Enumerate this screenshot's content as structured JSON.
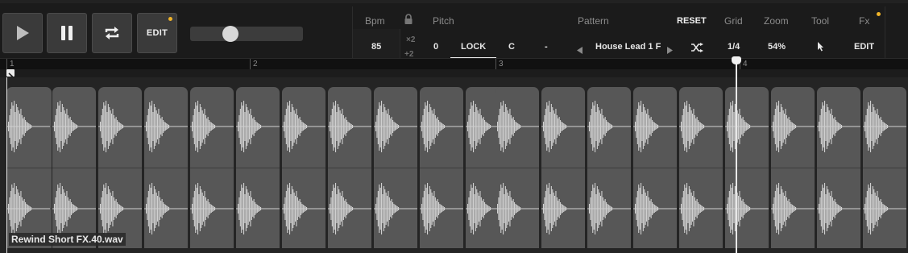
{
  "toolbar": {
    "play_label": "",
    "edit_label": "EDIT",
    "slider_value": 0.33
  },
  "params": {
    "bpm_label": "Bpm",
    "bpm_value": "85",
    "pitch_label": "Pitch",
    "mult_x2": "×2",
    "plus2": "+2",
    "pitch_value": "0",
    "lock_label": "LOCK",
    "key_value": "C",
    "key_suffix": "-",
    "pattern_label": "Pattern",
    "pattern_value": "House Lead 1 F",
    "reset_label": "RESET",
    "grid_label": "Grid",
    "grid_value": "1/4",
    "zoom_label": "Zoom",
    "zoom_value": "54%",
    "tool_label": "Tool",
    "fx_label": "Fx",
    "fx_edit_label": "EDIT"
  },
  "ruler": {
    "labels": [
      "1",
      "2",
      "3",
      "4"
    ]
  },
  "clip": {
    "name": "Rewind Short FX.40.wav"
  },
  "colors": {
    "accent_dot": "#f0b429",
    "clip_fill": "#575757",
    "waveform": "#d0d0d0"
  },
  "icons": {
    "play": "play-icon",
    "pause": "pause-icon",
    "loop": "loop-icon",
    "lock": "lock-icon",
    "prev": "triangle-left-icon",
    "next": "triangle-right-icon",
    "shuffle": "shuffle-icon",
    "cursor": "cursor-icon"
  }
}
